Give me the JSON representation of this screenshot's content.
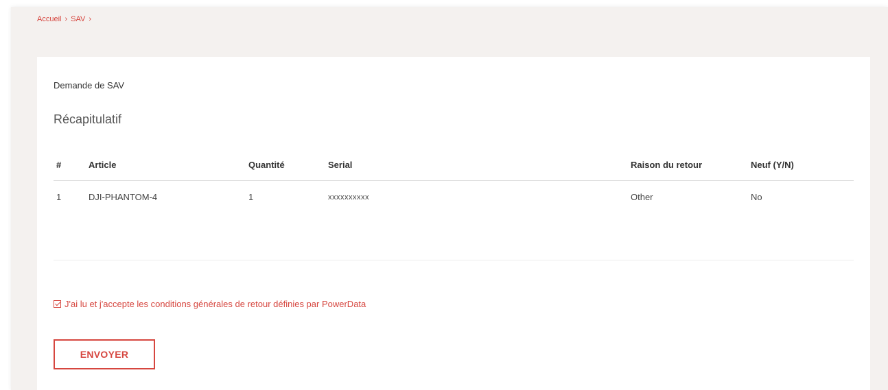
{
  "breadcrumb": {
    "items": [
      "Accueil",
      "SAV"
    ],
    "separator": "›"
  },
  "card": {
    "title": "Demande de SAV",
    "section_title": "Récapitulatif"
  },
  "table": {
    "headers": [
      "#",
      "Article",
      "Quantité",
      "Serial",
      "Raison du retour",
      "Neuf (Y/N)"
    ],
    "rows": [
      [
        "1",
        "DJI-PHANTOM-4",
        "1",
        "xxxxxxxxxx",
        "Other",
        "No"
      ]
    ]
  },
  "terms": {
    "checked": true,
    "label": "J'ai lu et j'accepte les conditions générales de retour définies par PowerData"
  },
  "actions": {
    "submit_label": "ENVOYER"
  },
  "colors": {
    "accent": "#d6463f",
    "page_background": "#f4f1ef",
    "card_background": "#ffffff"
  }
}
